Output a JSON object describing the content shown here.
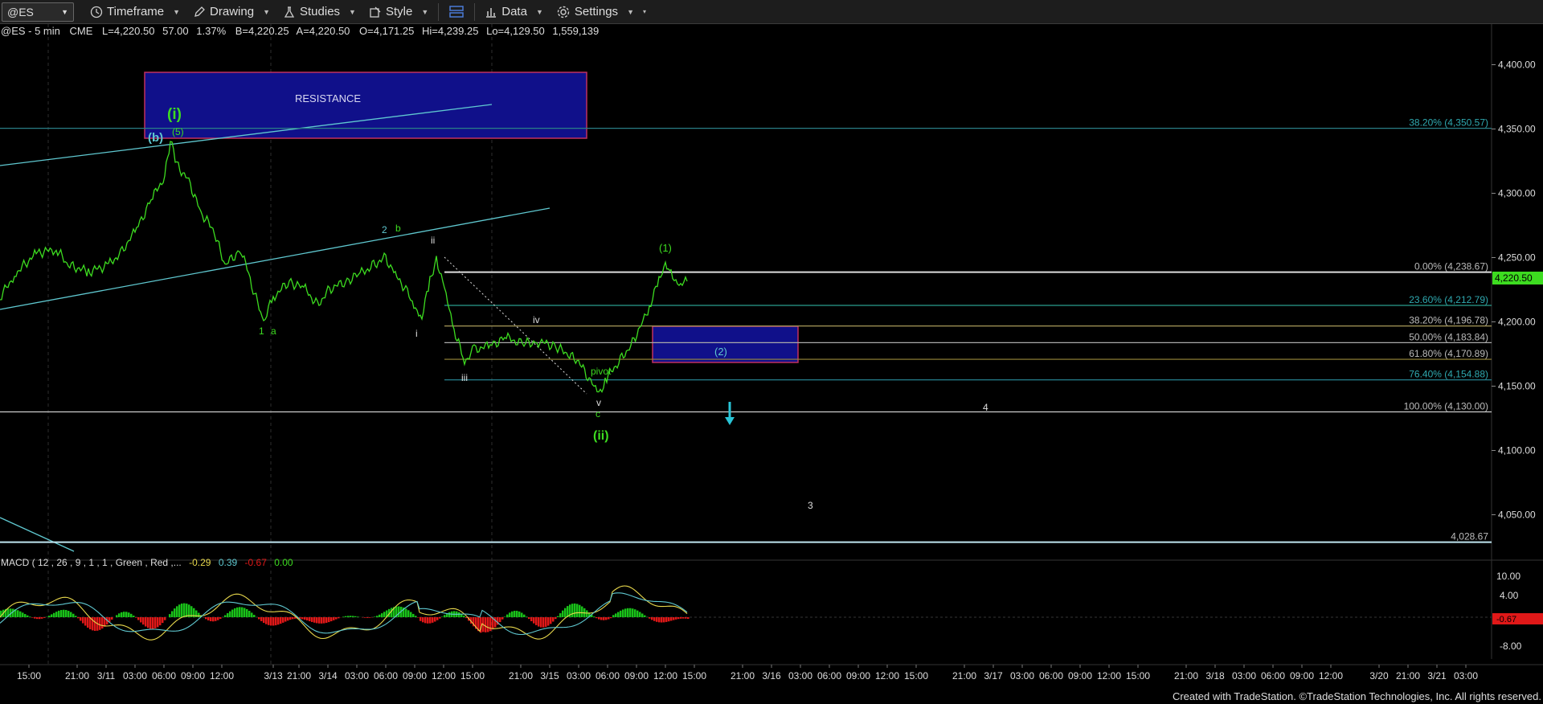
{
  "toolbar": {
    "symbol": "@ES",
    "timeframe": "Timeframe",
    "drawing": "Drawing",
    "studies": "Studies",
    "style": "Style",
    "data": "Data",
    "settings": "Settings"
  },
  "quote_header": {
    "symbol": "@ES - 5 min",
    "exchange": "CME",
    "last": "L=4,220.50",
    "change": "57.00",
    "change_pct": "1.37%",
    "bid": "B=4,220.25",
    "ask": "A=4,220.50",
    "open": "O=4,171.25",
    "high": "Hi=4,239.25",
    "low": "Lo=4,129.50",
    "volume": "1,559,139"
  },
  "price_axis": {
    "ticks": [
      "4,400.00",
      "4,350.00",
      "4,300.00",
      "4,250.00",
      "4,200.00",
      "4,150.00",
      "4,100.00",
      "4,050.00"
    ],
    "current_price": "4,220.50"
  },
  "fib_levels": [
    {
      "label": "38.20% (4,350.57)",
      "price": 4350.57
    },
    {
      "label": "0.00% (4,238.67)",
      "price": 4238.67
    },
    {
      "label": "23.60% (4,212.79)",
      "price": 4212.79
    },
    {
      "label": "38.20% (4,196.78)",
      "price": 4196.78
    },
    {
      "label": "50.00% (4,183.84)",
      "price": 4183.84
    },
    {
      "label": "61.80% (4,170.89)",
      "price": 4170.89
    },
    {
      "label": "76.40% (4,154.88)",
      "price": 4154.88
    },
    {
      "label": "100.00% (4,130.00)",
      "price": 4130.0
    },
    {
      "label": "4,028.67",
      "price": 4028.67
    }
  ],
  "annotations": {
    "resistance": "RESISTANCE",
    "target_box_label": "(2)",
    "wave_labels": [
      "(b)",
      "(i)",
      "(5)",
      "1",
      "a",
      "2",
      "b",
      "ii",
      "i",
      "iii",
      "iv",
      "v",
      "c",
      "(ii)",
      "(1)",
      "pivot",
      "3",
      "4"
    ]
  },
  "macd": {
    "title": "MACD ( 12 , 26 , 9 , 1 , 1 , Green , Red ,...",
    "val1": "-0.29",
    "val2": "0.39",
    "val3": "-0.67",
    "val4": "0.00",
    "ticks": [
      "10.00",
      "4.00",
      "-8.00"
    ],
    "current": "-0.67"
  },
  "time_axis": {
    "labels": [
      "15:00",
      "21:00",
      "3/11",
      "03:00",
      "06:00",
      "09:00",
      "12:00",
      "3/13",
      "21:00",
      "3/14",
      "03:00",
      "06:00",
      "09:00",
      "12:00",
      "15:00",
      "21:00",
      "3/15",
      "03:00",
      "06:00",
      "09:00",
      "12:00",
      "15:00",
      "21:00",
      "3/16",
      "03:00",
      "06:00",
      "09:00",
      "12:00",
      "15:00",
      "21:00",
      "3/17",
      "03:00",
      "06:00",
      "09:00",
      "12:00",
      "15:00",
      "21:00",
      "3/18",
      "03:00",
      "06:00",
      "09:00",
      "12:00",
      "3/20",
      "21:00",
      "3/21",
      "03:00"
    ]
  },
  "colors": {
    "background": "#000000",
    "price_line": "#3ddc20",
    "channel": "#5fc8d0",
    "fib_line": "#b5a36b",
    "resistance_fill": "#10108a",
    "resistance_border": "#c03060",
    "support_line": "#bfe5f0",
    "macd_up": "#19c219",
    "macd_down": "#e01818"
  },
  "footer": "Created with TradeStation. ©TradeStation Technologies, Inc. All rights reserved."
}
